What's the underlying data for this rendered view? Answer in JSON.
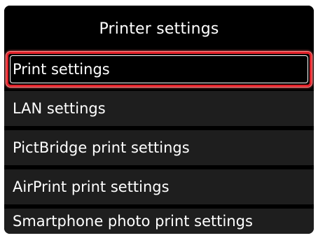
{
  "screen": {
    "title": "Printer settings"
  },
  "menu": {
    "items": [
      {
        "label": "Print settings",
        "selected": true
      },
      {
        "label": "LAN settings",
        "selected": false
      },
      {
        "label": "PictBridge print settings",
        "selected": false
      },
      {
        "label": "AirPrint print settings",
        "selected": false
      },
      {
        "label": "Smartphone photo print settings",
        "selected": false
      }
    ]
  },
  "colors": {
    "background": "#000000",
    "item_background": "#1e1e1e",
    "selection_border": "#e2222a",
    "text": "#ffffff"
  }
}
